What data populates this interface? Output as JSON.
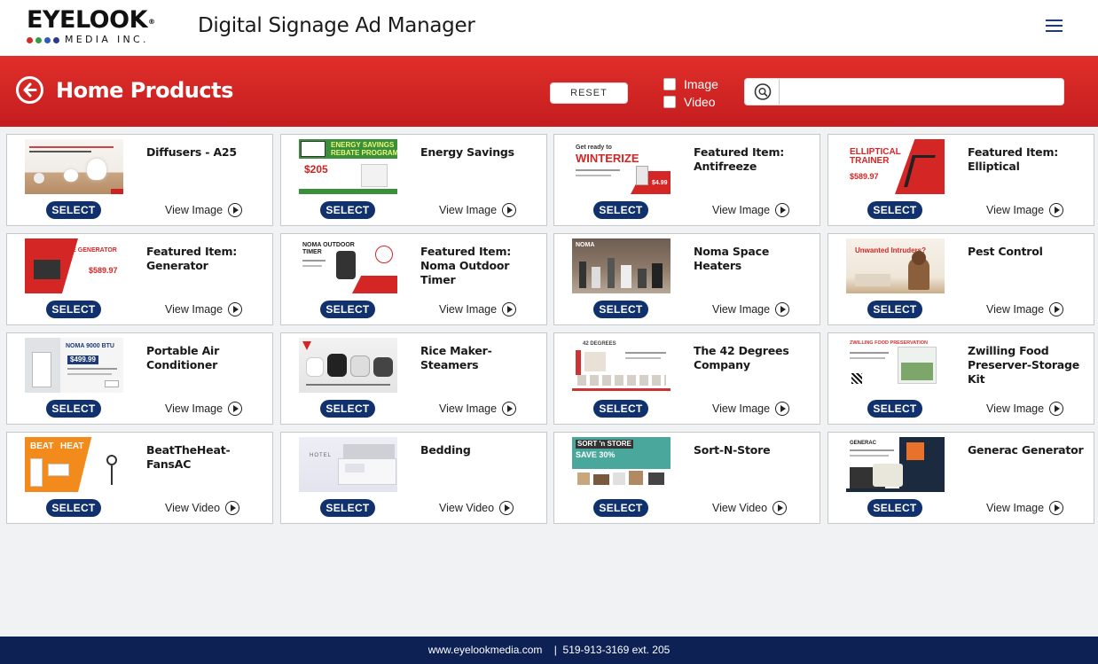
{
  "brand": {
    "logo_word": "EYELOOK",
    "logo_reg": "®",
    "logo_tagline": "MEDIA INC.",
    "dot_colors": [
      "#d52b2b",
      "#3b9b44",
      "#2b5fb5",
      "#2b3a8c"
    ]
  },
  "header": {
    "app_title": "Digital Signage Ad Manager"
  },
  "toolbar": {
    "page_title": "Home Products",
    "reset_label": "RESET",
    "filters": [
      {
        "label": "Image",
        "checked": false
      },
      {
        "label": "Video",
        "checked": false
      }
    ],
    "search_value": ""
  },
  "colors": {
    "accent_red": "#d42625",
    "navy": "#11306e",
    "footer": "#0d2155"
  },
  "products": [
    {
      "title": "Diffusers - A25",
      "action": "SELECT",
      "view": "View Image",
      "thumb": "diffuser-ad"
    },
    {
      "title": "Energy Savings",
      "action": "SELECT",
      "view": "View Image",
      "thumb": "energy-savings-ad"
    },
    {
      "title": "Featured Item: Antifreeze",
      "action": "SELECT",
      "view": "View Image",
      "thumb": "antifreeze-ad"
    },
    {
      "title": "Featured Item: Elliptical",
      "action": "SELECT",
      "view": "View Image",
      "thumb": "elliptical-ad"
    },
    {
      "title": "Featured Item: Generator",
      "action": "SELECT",
      "view": "View Image",
      "thumb": "generator-ad"
    },
    {
      "title": "Featured Item: Noma Outdoor Timer",
      "action": "SELECT",
      "view": "View Image",
      "thumb": "timer-ad"
    },
    {
      "title": "Noma Space Heaters",
      "action": "SELECT",
      "view": "View Image",
      "thumb": "heaters-ad"
    },
    {
      "title": "Pest Control",
      "action": "SELECT",
      "view": "View Image",
      "thumb": "pest-ad"
    },
    {
      "title": "Portable Air Conditioner",
      "action": "SELECT",
      "view": "View Image",
      "thumb": "ac-ad"
    },
    {
      "title": "Rice Maker-Steamers",
      "action": "SELECT",
      "view": "View Image",
      "thumb": "rice-ad"
    },
    {
      "title": "The 42 Degrees Company",
      "action": "SELECT",
      "view": "View Image",
      "thumb": "42degrees-ad"
    },
    {
      "title": "Zwilling Food Preserver-Storage Kit",
      "action": "SELECT",
      "view": "View Image",
      "thumb": "zwilling-ad"
    },
    {
      "title": "BeatTheHeat-FansAC",
      "action": "SELECT",
      "view": "View Video",
      "thumb": "beattheheat-ad"
    },
    {
      "title": "Bedding",
      "action": "SELECT",
      "view": "View Video",
      "thumb": "bedding-ad"
    },
    {
      "title": "Sort-N-Store",
      "action": "SELECT",
      "view": "View Video",
      "thumb": "sortnstore-ad"
    },
    {
      "title": "Generac Generator",
      "action": "SELECT",
      "view": "View Image",
      "thumb": "generac-ad"
    }
  ],
  "thumb_text": {
    "energy": "ENERGY SAVINGS",
    "energy2": "REBATE PROGRAM",
    "energy_price": "$205",
    "antifreeze_a": "Get ready to",
    "antifreeze_b": "WINTERIZE",
    "antifreeze_price": "$4.99",
    "elliptical": "ELLIPTICAL",
    "elliptical2": "TRAINER",
    "elliptical_price": "$589.97",
    "generator": "ELITE GENERATOR",
    "generator_price": "$589.97",
    "timer": "NOMA OUTDOOR",
    "timer2": "TIMER",
    "heaters": "NOMA",
    "pest": "Unwanted Intruders?",
    "ac": "NOMA 9000 BTU",
    "ac_price": "$499.99",
    "degrees": "42 DEGREES",
    "zwilling": "ZWILLING FOOD PRESERVATION",
    "beat": "BEAT",
    "beat2": "HEAT",
    "bedding": "HOTEL",
    "sort": "SORT 'n STORE",
    "sort2": "SAVE 30%",
    "generac": "GENERAC"
  },
  "footer": {
    "text": "www.eyelookmedia.com    |  519-913-3169 ext. 205"
  }
}
